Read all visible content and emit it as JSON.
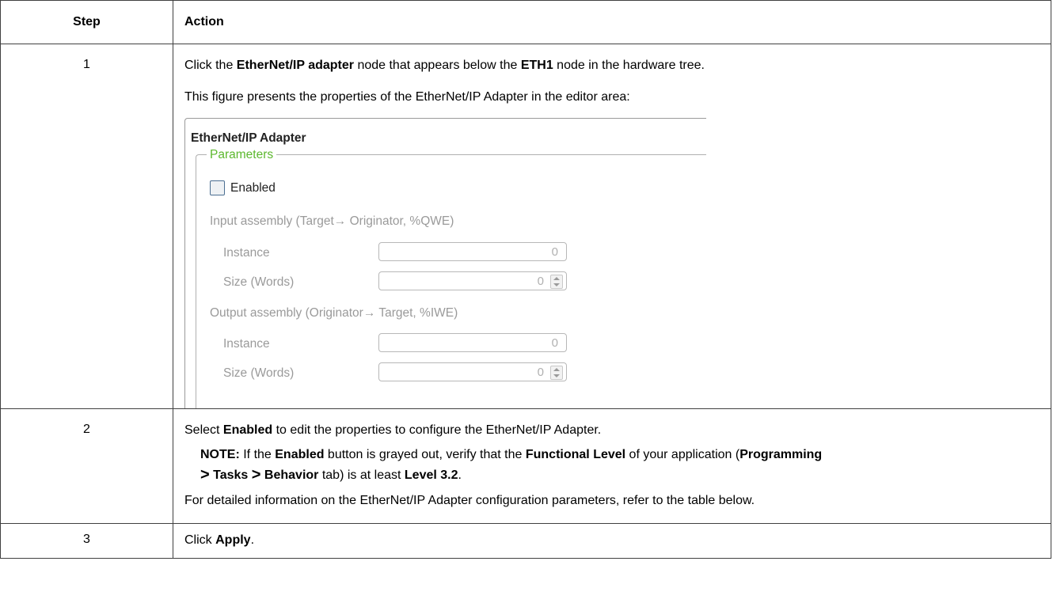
{
  "table": {
    "headers": {
      "step": "Step",
      "action": "Action"
    },
    "rows": [
      {
        "step": "1",
        "p1": {
          "a": "Click the ",
          "b": "EtherNet/IP adapter",
          "c": " node that appears below the ",
          "d": "ETH1",
          "e": " node in the hardware tree."
        },
        "p2": "This figure presents the properties of the EtherNet/IP Adapter in the editor area:"
      },
      {
        "step": "2",
        "p1": {
          "a": "Select ",
          "b": "Enabled",
          "c": " to edit the properties to configure the EtherNet/IP Adapter."
        },
        "note": {
          "label": "NOTE:",
          "t1": " If the ",
          "t2": "Enabled",
          "t3": " button is grayed out, verify that the ",
          "t4": "Functional Level",
          "t5": " of your application (",
          "t6": "Programming",
          "gt1": ">",
          "t7": "Tasks",
          "gt2": ">",
          "t8": "Behavior",
          "t9": " tab) is at least ",
          "t10": "Level 3.2",
          "t11": "."
        },
        "p2": "For detailed information on the EtherNet/IP Adapter configuration parameters, refer to the table below."
      },
      {
        "step": "3",
        "p1": {
          "a": "Click ",
          "b": "Apply",
          "c": "."
        }
      }
    ]
  },
  "figure": {
    "title": "EtherNet/IP Adapter",
    "group_label": "Parameters",
    "checkbox_label": "Enabled",
    "checkbox_checked": false,
    "input_assembly": {
      "heading": "Input assembly (Target→ Originator, %QWE)",
      "instance_label": "Instance",
      "instance_value": "0",
      "size_label": "Size (Words)",
      "size_value": "0"
    },
    "output_assembly": {
      "heading": "Output assembly (Originator→ Target, %IWE)",
      "instance_label": "Instance",
      "instance_value": "0",
      "size_label": "Size (Words)",
      "size_value": "0"
    },
    "colors": {
      "group_label": "#5cb82e",
      "disabled_text": "#9a9a9a"
    },
    "icons": {
      "spinner": "up-down-spinner-icon"
    }
  }
}
